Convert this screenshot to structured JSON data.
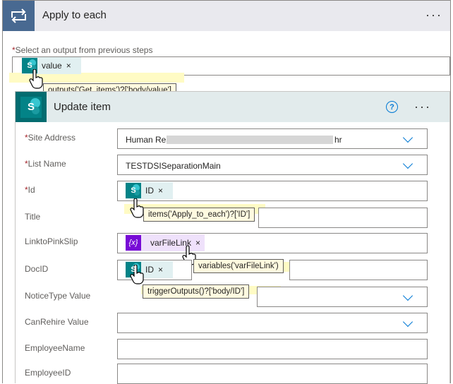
{
  "apply_each": {
    "title": "Apply to each",
    "more_label": "···",
    "select_label": "Select an output from previous steps",
    "select_token": "value",
    "select_tooltip": "outputs('Get_items')?['body/value']"
  },
  "update_item": {
    "title": "Update item",
    "help_label": "?",
    "more_label": "···"
  },
  "fields": {
    "site_address": {
      "label": "Site Address",
      "value_start": "Human Res",
      "value_end": "hr"
    },
    "list_name": {
      "label": "List Name",
      "value": "TESTDSISeparationMain"
    },
    "id": {
      "label": "Id",
      "token": "ID",
      "tooltip": "items('Apply_to_each')?['ID']"
    },
    "title": {
      "label": "Title"
    },
    "link": {
      "label": "LinktoPinkSlip",
      "token": "varFileLink",
      "tooltip": "variables('varFileLink')",
      "expr_symbol": "{x}"
    },
    "docid": {
      "label": "DocID",
      "token": "ID",
      "tooltip": "triggerOutputs()?['body/ID']"
    },
    "notice": {
      "label": "NoticeType Value"
    },
    "rehire": {
      "label": "CanRehire Value"
    },
    "emp_name": {
      "label": "EmployeeName"
    },
    "emp_id": {
      "label": "EmployeeID"
    }
  },
  "common": {
    "required_star": "*",
    "remove_x": "×",
    "sp_letter": "S"
  },
  "colors": {
    "loop_header": "#486991",
    "sharepoint": "#038387",
    "variable": "#770bd6",
    "accent": "#0078d4"
  }
}
